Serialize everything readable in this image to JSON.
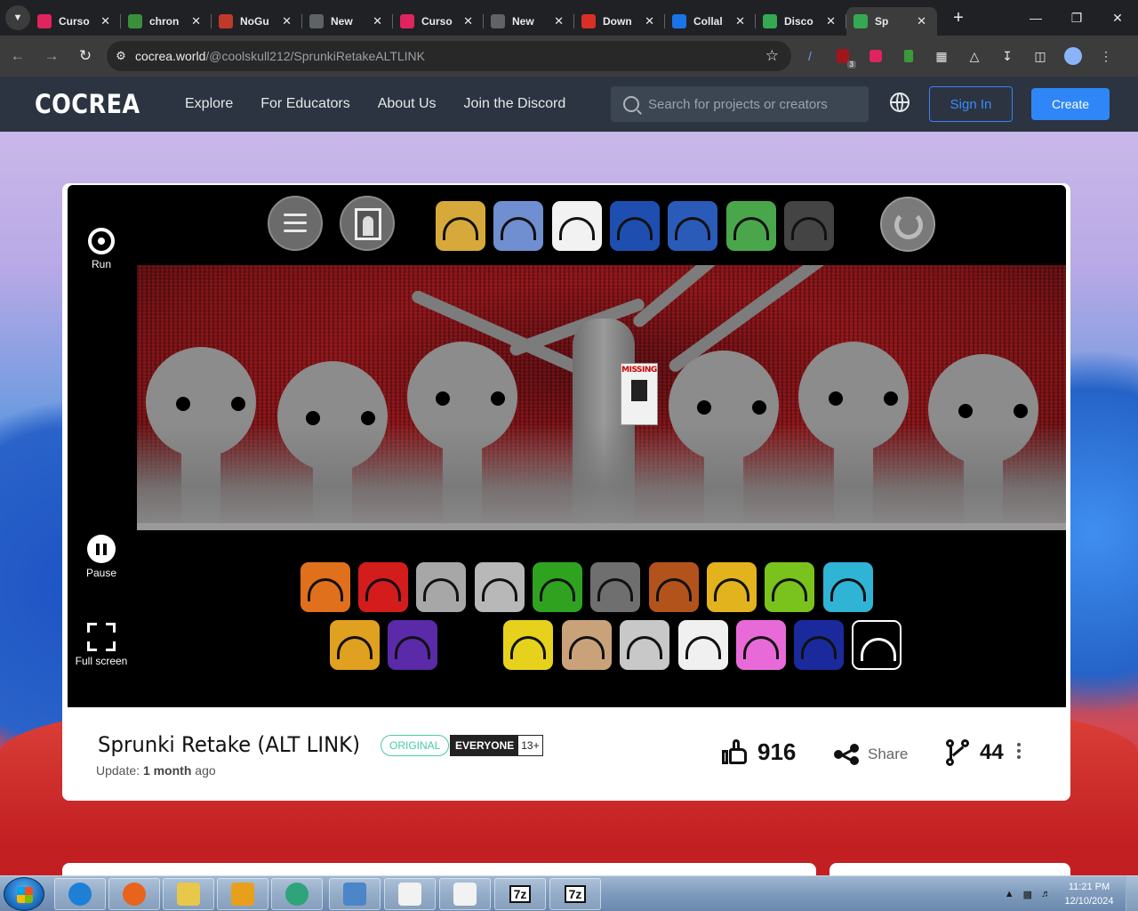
{
  "browser": {
    "tabs": [
      {
        "label": "Curso",
        "favicon": "cursor-icon",
        "color": "#e0245e"
      },
      {
        "label": "chron",
        "favicon": "puzzle-icon",
        "color": "#3a8f3a"
      },
      {
        "label": "NoGu",
        "favicon": "image-icon",
        "color": "#c0392b"
      },
      {
        "label": "New",
        "favicon": "globe-icon",
        "color": "#5f6368"
      },
      {
        "label": "Curso",
        "favicon": "cursor-icon",
        "color": "#e0245e"
      },
      {
        "label": "New",
        "favicon": "globe-icon",
        "color": "#5f6368"
      },
      {
        "label": "Down",
        "favicon": "gmail-icon",
        "color": "#d93025"
      },
      {
        "label": "Collal",
        "favicon": "search-icon",
        "color": "#1a73e8"
      },
      {
        "label": "Disco",
        "favicon": "cocrea-icon",
        "color": "#34a853"
      },
      {
        "label": "Sp",
        "favicon": "cocrea-icon",
        "color": "#34a853",
        "active": true
      }
    ],
    "url_host": "cocrea.world",
    "url_path": "/@coolskull212/SprunkiRetakeALTLINK",
    "ext_badge": "3"
  },
  "site": {
    "logo": "COCREA",
    "nav": [
      "Explore",
      "For Educators",
      "About Us",
      "Join the Discord"
    ],
    "search_placeholder": "Search for projects or creators",
    "sign_in": "Sign In",
    "create": "Create"
  },
  "player": {
    "run_label": "Run",
    "pause_label": "Pause",
    "fullscreen_label": "Full screen",
    "poster_text": "MISSING",
    "top_icons": [
      {
        "name": "yellow-crown-icon",
        "bg": "#d6a93a"
      },
      {
        "name": "blue-dome-icon",
        "bg": "#6f8fd0"
      },
      {
        "name": "notebook-icon",
        "bg": "#f2f2f2"
      },
      {
        "name": "blue-crown-icon",
        "bg": "#1e4fb0"
      },
      {
        "name": "red-hat-icon",
        "bg": "#2a5bb8"
      },
      {
        "name": "green-monsters-icon",
        "bg": "#4aa64a"
      },
      {
        "name": "cat-cap-icon",
        "bg": "#444444"
      }
    ],
    "bottom_icons_row1": [
      {
        "name": "orange-character-icon",
        "bg": "#e0701c"
      },
      {
        "name": "red-spiky-icon",
        "bg": "#d41c1c"
      },
      {
        "name": "gray-antenna-icon",
        "bg": "#a7a7a7"
      },
      {
        "name": "gray-box-icon",
        "bg": "#b8b8b8"
      },
      {
        "name": "green-leaf-icon",
        "bg": "#2fa320"
      },
      {
        "name": "gray-cat-icon",
        "bg": "#6f6f6f"
      },
      {
        "name": "brown-tophat-icon",
        "bg": "#b3531c"
      },
      {
        "name": "yellow-bed-icon",
        "bg": "#e2b31c"
      },
      {
        "name": "lime-spiky-icon",
        "bg": "#7ac31c"
      },
      {
        "name": "cyan-headphones-icon",
        "bg": "#2fb4d6"
      }
    ],
    "bottom_icons_row2": [
      {
        "name": "gold-star-icon",
        "bg": "#e0a020"
      },
      {
        "name": "purple-horns-icon",
        "bg": "#5a2aa8"
      },
      {
        "name": "yellow-lightning-icon",
        "bg": "#e6d21c"
      },
      {
        "name": "tan-hat-icon",
        "bg": "#caa27a"
      },
      {
        "name": "propeller-cap-icon",
        "bg": "#c8c8c8"
      },
      {
        "name": "white-cat-icon",
        "bg": "#f0f0f0"
      },
      {
        "name": "pink-bunny-icon",
        "bg": "#e86ad8"
      },
      {
        "name": "navy-dome-icon",
        "bg": "#1a2a9c"
      },
      {
        "name": "bench-icon",
        "bg": "#000000"
      }
    ]
  },
  "project": {
    "title": "Sprunki Retake (ALT LINK)",
    "tag_original": "ORIGINAL",
    "rating_label": "EVERYONE",
    "rating_age": "13+",
    "update_prefix": "Update:",
    "update_value": "1 month",
    "update_suffix": "ago",
    "likes": "916",
    "share_label": "Share",
    "remixes": "44"
  },
  "taskbar": {
    "time": "11:21 PM",
    "date": "12/10/2024",
    "apps": [
      "ie-icon",
      "firefox-icon",
      "explorer-icon",
      "media-player-icon",
      "chrome-icon",
      "control-panel-icon",
      "document-icon",
      "document-icon",
      "7zip-icon",
      "7zip-icon"
    ],
    "seven_zip_label": "7z"
  }
}
